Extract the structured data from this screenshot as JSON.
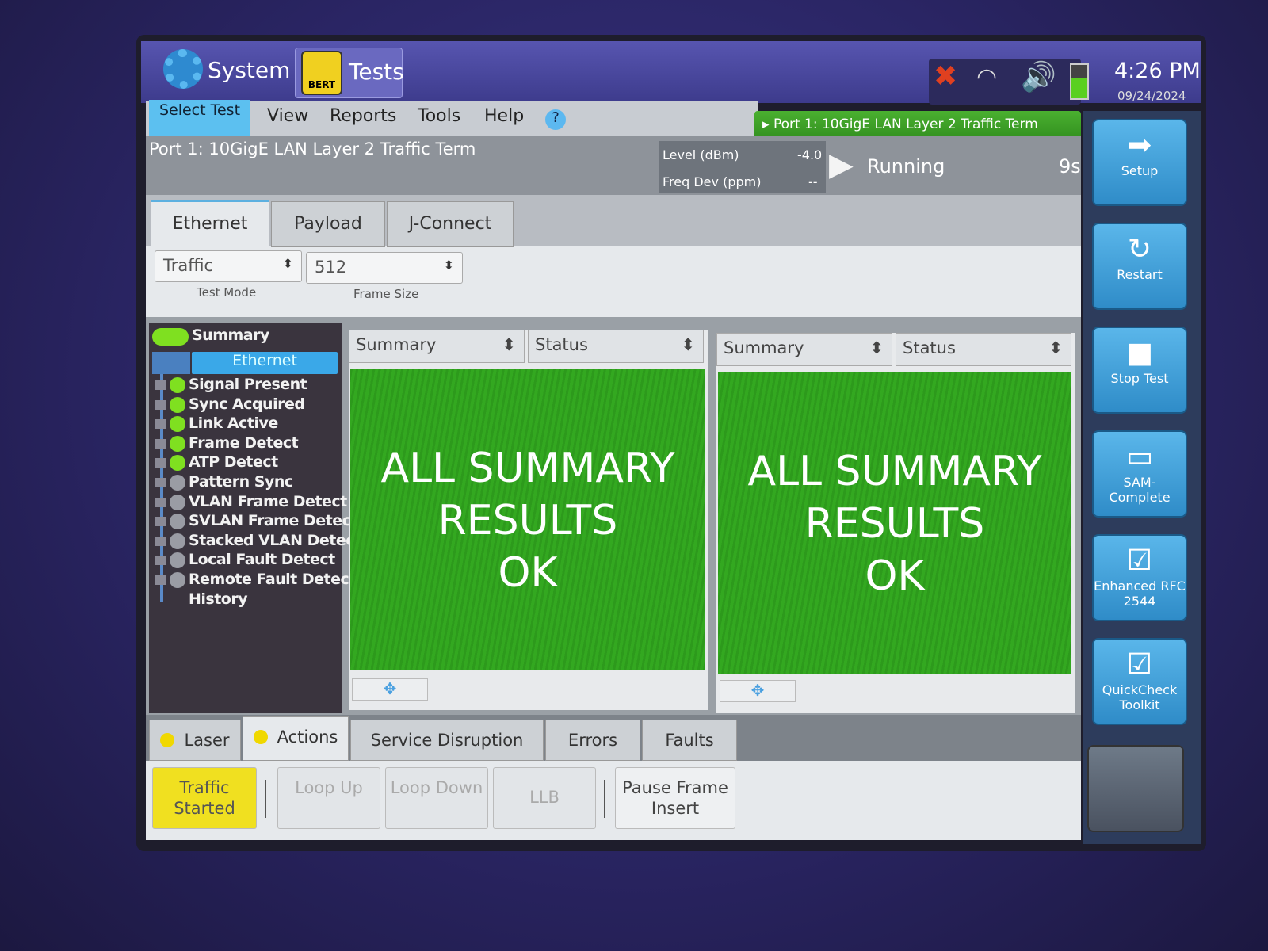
{
  "topbar": {
    "system_label": "System",
    "tests_label": "Tests",
    "bert_label": "BERT",
    "time": "4:26 PM",
    "date": "09/24/2024",
    "icons": [
      "cloud-disconnected-icon",
      "wifi-icon",
      "speaker-icon",
      "battery-icon"
    ]
  },
  "menu": {
    "select_test": "Select Test",
    "items": [
      "View",
      "Reports",
      "Tools",
      "Help"
    ],
    "help_icon": "question-icon"
  },
  "port_tab": "Port 1: 10GigE LAN Layer 2 Traffic Term",
  "info": {
    "title": "Port 1: 10GigE LAN Layer 2 Traffic Term",
    "level_label": "Level (dBm)",
    "level_value": "-4.0",
    "freq_label": "Freq Dev (ppm)",
    "freq_value": "--",
    "status": "Running",
    "elapsed": "9s"
  },
  "tabs": [
    {
      "label": "Ethernet",
      "active": true
    },
    {
      "label": "Payload"
    },
    {
      "label": "J-Connect"
    }
  ],
  "form": {
    "test_mode": {
      "value": "Traffic",
      "label": "Test Mode"
    },
    "frame_size": {
      "value": "512",
      "label": "Frame Size"
    }
  },
  "tree": {
    "summary": "Summary",
    "group": "Ethernet",
    "items": [
      {
        "label": "Signal Present",
        "ok": true
      },
      {
        "label": "Sync Acquired",
        "ok": true
      },
      {
        "label": "Link Active",
        "ok": true
      },
      {
        "label": "Frame Detect",
        "ok": true
      },
      {
        "label": "ATP Detect",
        "ok": true
      },
      {
        "label": "Pattern Sync",
        "ok": false
      },
      {
        "label": "VLAN Frame Detect",
        "ok": false
      },
      {
        "label": "SVLAN Frame Detect",
        "ok": false
      },
      {
        "label": "Stacked VLAN Detect",
        "ok": false
      },
      {
        "label": "Local Fault Detect",
        "ok": false
      },
      {
        "label": "Remote Fault Detect",
        "ok": false
      }
    ],
    "history": "History"
  },
  "panes": [
    {
      "group": "Summary",
      "category": "Status",
      "line1": "ALL SUMMARY",
      "line2": "RESULTS",
      "line3": "OK"
    },
    {
      "group": "Summary",
      "category": "Status",
      "line1": "ALL SUMMARY",
      "line2": "RESULTS",
      "line3": "OK"
    }
  ],
  "bottom_tabs": [
    "Laser",
    "Actions",
    "Service Disruption",
    "Errors",
    "Faults"
  ],
  "actions": {
    "traffic": "Traffic Started",
    "loop_up": "Loop Up",
    "loop_down": "Loop Down",
    "llb": "LLB",
    "pause": "Pause Frame Insert"
  },
  "side_buttons": [
    {
      "label": "Setup",
      "icon": "arrow-right-icon"
    },
    {
      "label": "Restart",
      "icon": "restart-icon"
    },
    {
      "label": "Stop Test",
      "icon": "stop-icon"
    },
    {
      "label": "SAM-Complete",
      "icon": "window-icon"
    },
    {
      "label": "Enhanced RFC 2544",
      "icon": "checkbox-plus-icon"
    },
    {
      "label": "QuickCheck Toolkit",
      "icon": "checkbox-icon"
    }
  ],
  "colors": {
    "accent": "#5cc0f0",
    "ok_green": "#33a820",
    "warn_yellow": "#f0d800"
  }
}
